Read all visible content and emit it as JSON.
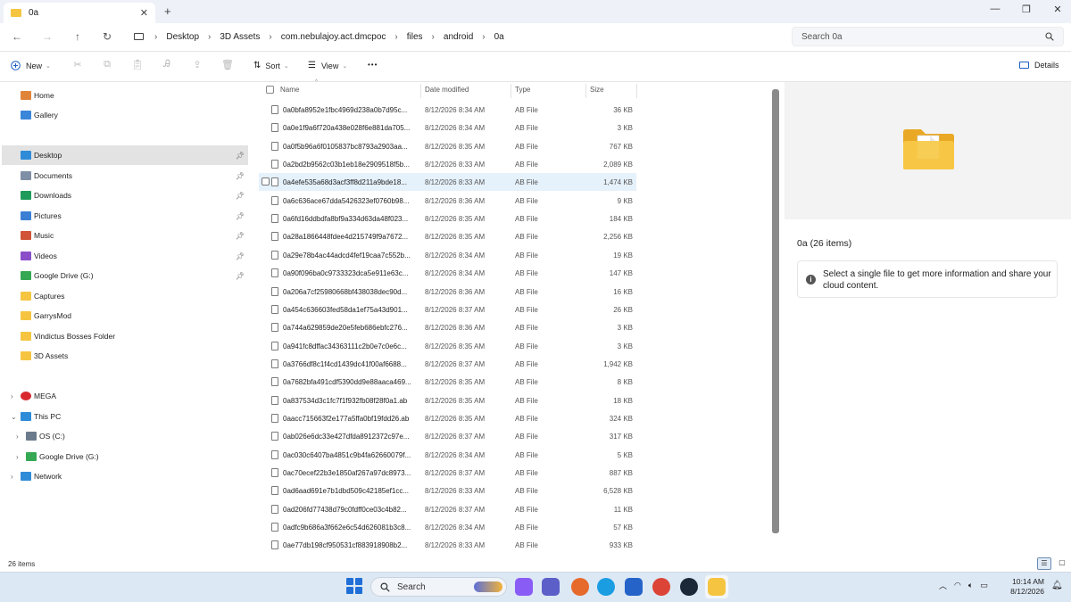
{
  "window": {
    "tab_title": "0a",
    "tab_close": "✕",
    "new_tab": "+",
    "minimize": "—",
    "maximize": "❐",
    "close": "✕"
  },
  "nav": {
    "back": "←",
    "forward": "→",
    "up": "↑",
    "refresh": "↻"
  },
  "breadcrumb": [
    "Desktop",
    "3D Assets",
    "com.nebulajoy.act.dmcpoc",
    "files",
    "android",
    "0a"
  ],
  "search": {
    "placeholder": "Search 0a"
  },
  "toolbar": {
    "new_label": "New",
    "sort_label": "Sort",
    "view_label": "View",
    "more_label": "•••",
    "details_label": "Details"
  },
  "sidebar": {
    "items": [
      {
        "label": "Home",
        "icon": "home-icon",
        "color": "#e0843a"
      },
      {
        "label": "Gallery",
        "icon": "gallery-icon",
        "color": "#3a86d8"
      },
      {
        "label": "Desktop",
        "icon": "desktop-icon",
        "color": "#2e8bd8",
        "pinned": true,
        "selected": true
      },
      {
        "label": "Documents",
        "icon": "documents-icon",
        "color": "#7f8fa6",
        "pinned": true
      },
      {
        "label": "Downloads",
        "icon": "downloads-icon",
        "color": "#1e9b58",
        "pinned": true
      },
      {
        "label": "Pictures",
        "icon": "pictures-icon",
        "color": "#3a7fd4",
        "pinned": true
      },
      {
        "label": "Music",
        "icon": "music-icon",
        "color": "#d0533a",
        "pinned": true
      },
      {
        "label": "Videos",
        "icon": "videos-icon",
        "color": "#8a4fc8",
        "pinned": true
      },
      {
        "label": "Google Drive (G:)",
        "icon": "google-drive-icon",
        "color": "#34a853",
        "pinned": true
      },
      {
        "label": "Captures",
        "icon": "folder-icon",
        "color": "#f5c542"
      },
      {
        "label": "GarrysMod",
        "icon": "folder-icon",
        "color": "#f5c542"
      },
      {
        "label": "Vindictus Bosses Folder",
        "icon": "folder-icon",
        "color": "#f5c542"
      },
      {
        "label": "3D Assets",
        "icon": "folder-icon",
        "color": "#f5c542"
      }
    ],
    "tree": [
      {
        "label": "MEGA",
        "icon": "mega-icon",
        "color": "#d9272e",
        "expander": "›"
      },
      {
        "label": "This PC",
        "icon": "this-pc-icon",
        "color": "#2e8bd8",
        "expander": "⌄"
      },
      {
        "label": "OS (C:)",
        "icon": "drive-icon",
        "color": "#6b7b8c",
        "expander": "›",
        "indent": true
      },
      {
        "label": "Google Drive (G:)",
        "icon": "google-drive-icon",
        "color": "#34a853",
        "expander": "›",
        "indent": true
      },
      {
        "label": "Network",
        "icon": "network-icon",
        "color": "#2e8bd8",
        "expander": "›"
      }
    ]
  },
  "columns": {
    "name": "Name",
    "date": "Date modified",
    "type": "Type",
    "size": "Size"
  },
  "files": [
    {
      "name": "0a0bfa8952e1fbc4969d238a0b7d95c...",
      "date": "8/12/2026 8:34 AM",
      "type": "AB File",
      "size": "36 KB"
    },
    {
      "name": "0a0e1f9a6f720a438e028f6e881da705...",
      "date": "8/12/2026 8:34 AM",
      "type": "AB File",
      "size": "3 KB"
    },
    {
      "name": "0a0f5b96a6f0105837bc8793a2903aa...",
      "date": "8/12/2026 8:35 AM",
      "type": "AB File",
      "size": "767 KB"
    },
    {
      "name": "0a2bd2b9562c03b1eb18e2909518f5b...",
      "date": "8/12/2026 8:33 AM",
      "type": "AB File",
      "size": "2,089 KB"
    },
    {
      "name": "0a4efe535a68d3acf3ff8d211a9bde18...",
      "date": "8/12/2026 8:33 AM",
      "type": "AB File",
      "size": "1,474 KB",
      "hover": true
    },
    {
      "name": "0a6c636ace67dda5426323ef0760b98...",
      "date": "8/12/2026 8:36 AM",
      "type": "AB File",
      "size": "9 KB"
    },
    {
      "name": "0a6fd16ddbdfa8bf9a334d63da48f023...",
      "date": "8/12/2026 8:35 AM",
      "type": "AB File",
      "size": "184 KB"
    },
    {
      "name": "0a28a1866448fdee4d215749f9a7672...",
      "date": "8/12/2026 8:35 AM",
      "type": "AB File",
      "size": "2,256 KB"
    },
    {
      "name": "0a29e78b4ac44adcd4fef19caa7c552b...",
      "date": "8/12/2026 8:34 AM",
      "type": "AB File",
      "size": "19 KB"
    },
    {
      "name": "0a90f096ba0c9733323dca5e911e63c...",
      "date": "8/12/2026 8:34 AM",
      "type": "AB File",
      "size": "147 KB"
    },
    {
      "name": "0a206a7cf25980668bf438038dec90d...",
      "date": "8/12/2026 8:36 AM",
      "type": "AB File",
      "size": "16 KB"
    },
    {
      "name": "0a454c636603fed58da1ef75a43d901...",
      "date": "8/12/2026 8:37 AM",
      "type": "AB File",
      "size": "26 KB"
    },
    {
      "name": "0a744a629859de20e5feb686ebfc276...",
      "date": "8/12/2026 8:36 AM",
      "type": "AB File",
      "size": "3 KB"
    },
    {
      "name": "0a941fc8dffac34363111c2b0e7c0e6c...",
      "date": "8/12/2026 8:35 AM",
      "type": "AB File",
      "size": "3 KB"
    },
    {
      "name": "0a3766df8c1f4cd1439dc41f00af6688...",
      "date": "8/12/2026 8:37 AM",
      "type": "AB File",
      "size": "1,942 KB"
    },
    {
      "name": "0a7682bfa491cdf5390dd9e88aaca469...",
      "date": "8/12/2026 8:35 AM",
      "type": "AB File",
      "size": "8 KB"
    },
    {
      "name": "0a837534d3c1fc7f1f932fb08f28f0a1.ab",
      "date": "8/12/2026 8:35 AM",
      "type": "AB File",
      "size": "18 KB"
    },
    {
      "name": "0aacc715663f2e177a5ffa0bf19fdd26.ab",
      "date": "8/12/2026 8:35 AM",
      "type": "AB File",
      "size": "324 KB"
    },
    {
      "name": "0ab026e6dc33e427dfda8912372c97e...",
      "date": "8/12/2026 8:37 AM",
      "type": "AB File",
      "size": "317 KB"
    },
    {
      "name": "0ac030c6407ba4851c9b4fa62660079f...",
      "date": "8/12/2026 8:34 AM",
      "type": "AB File",
      "size": "5 KB"
    },
    {
      "name": "0ac70ecef22b3e1850af267a97dc8973...",
      "date": "8/12/2026 8:37 AM",
      "type": "AB File",
      "size": "887 KB"
    },
    {
      "name": "0ad6aad691e7b1dbd509c42185ef1cc...",
      "date": "8/12/2026 8:33 AM",
      "type": "AB File",
      "size": "6,528 KB"
    },
    {
      "name": "0ad206fd77438d79c0fdff0ce03c4b82...",
      "date": "8/12/2026 8:37 AM",
      "type": "AB File",
      "size": "11 KB"
    },
    {
      "name": "0adfc9b686a3f662e6c54d626081b3c8...",
      "date": "8/12/2026 8:34 AM",
      "type": "AB File",
      "size": "57 KB"
    },
    {
      "name": "0ae77db198cf950531cf883918908b2...",
      "date": "8/12/2026 8:33 AM",
      "type": "AB File",
      "size": "933 KB"
    }
  ],
  "details": {
    "title": "0a (26 items)",
    "info": "Select a single file to get more information and share your cloud content."
  },
  "status": {
    "count": "26 items"
  },
  "taskbar": {
    "search_label": "Search",
    "clock_time": "10:14 AM",
    "clock_date": "8/12/2026",
    "apps": [
      {
        "icon": "copilot-icon",
        "color": "#8a5cf6"
      },
      {
        "icon": "teams-icon",
        "color": "#5b5fc7"
      },
      {
        "icon": "firefox-icon",
        "color": "#e66a2c"
      },
      {
        "icon": "edge-icon",
        "color": "#1b9de2"
      },
      {
        "icon": "store-icon",
        "color": "#2563c9"
      },
      {
        "icon": "chrome-icon",
        "color": "#db4437"
      },
      {
        "icon": "steam-icon",
        "color": "#1b2838"
      },
      {
        "icon": "file-explorer-icon",
        "color": "#f5c542"
      }
    ]
  }
}
